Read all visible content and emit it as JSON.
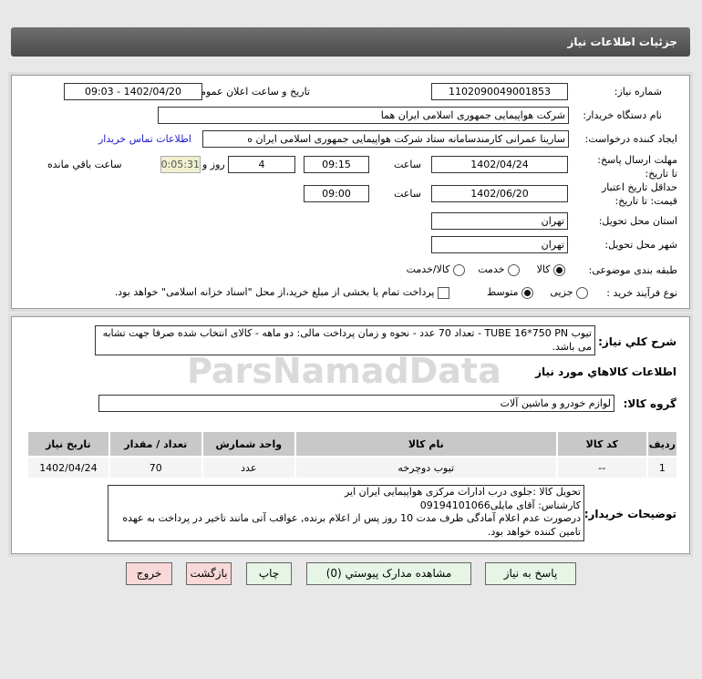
{
  "header": {
    "title": "جزئیات اطلاعات نیاز"
  },
  "form": {
    "need_number_label": "شماره نیاز:",
    "need_number": "1102090049001853",
    "announce_label": "تاریخ و ساعت اعلان عمومی:",
    "announce_value": "1402/04/20 - 09:03",
    "buyer_label": "نام دستگاه خریدار:",
    "buyer": "شرکت هواپیمایی جمهوری اسلامی ایران هما",
    "creator_label": "ایجاد کننده درخواست:",
    "creator": "سارینا عمرانی کارمندسامانه ستاد شرکت هواپیمایی جمهوری اسلامی ایران ه",
    "contact_link": "اطلاعات تماس خریدار",
    "deadline_label": "مهلت ارسال پاسخ: تا تاریخ:",
    "deadline_date": "1402/04/24",
    "time_label": "ساعت",
    "deadline_time": "09:15",
    "days": "4",
    "days_label": "روز و",
    "remaining": "00:05:31",
    "remaining_label": "ساعت باقي مانده",
    "validity_label": "حداقل تاریخ اعتبار قیمت: تا تاریخ:",
    "validity_date": "1402/06/20",
    "validity_time": "09:00",
    "province_label": "استان محل تحویل:",
    "province": "تهران",
    "city_label": "شهر محل تحویل:",
    "city": "تهران",
    "category_label": "طبقه بندی موضوعی:",
    "category_options": [
      "کالا",
      "خدمت",
      "کالا/خدمت"
    ],
    "category_selected": "کالا",
    "process_label": "نوع فرآیند خرید :",
    "process_options": [
      "جزیی",
      "متوسط"
    ],
    "process_selected": "متوسط",
    "payment_note": "پرداخت تمام یا بخشی از مبلغ خرید،از محل \"اسناد خزانه اسلامی\" خواهد بود."
  },
  "details": {
    "desc_label": "شرح کلي نياز:",
    "desc": "تیوب TUBE 16*750 PN - تعداد 70 عدد - نحوه و زمان پرداخت مالی: دو ماهه - کالای انتخاب شده صرفا جهت تشابه می باشد.",
    "goods_title": "اطلاعات کالاهاي مورد نياز",
    "group_label": "گروه کالا:",
    "group": "لوازم خودرو و ماشین آلات",
    "table": {
      "headers": [
        "ردیف",
        "کد کالا",
        "نام کالا",
        "واحد شمارش",
        "تعداد / مقدار",
        "تاریخ نیاز"
      ],
      "rows": [
        [
          "1",
          "--",
          "تیوب دوچرخه",
          "عدد",
          "70",
          "1402/04/24"
        ]
      ]
    },
    "notes_label": "توضیحات خریدار:",
    "notes": [
      "تحویل کالا :جلوی درب ادارات مرکزی هواپیمایی ایران ایر",
      "کارشناس: آقای مایلی09194101066",
      "درصورت عدم اعلام آمادگی ظرف مدت 10 روز پس از اعلام برنده, عواقب آتی مانند تاخیر در پرداخت به عهده تامین کننده خواهد بود."
    ]
  },
  "buttons": {
    "reply": "پاسخ به نیاز",
    "attachments": "مشاهده مدارک پیوستي (0)",
    "print": "چاپ",
    "back": "بازگشت",
    "exit": "خروج"
  },
  "watermark": {
    "brand": "ParsNamadData"
  }
}
